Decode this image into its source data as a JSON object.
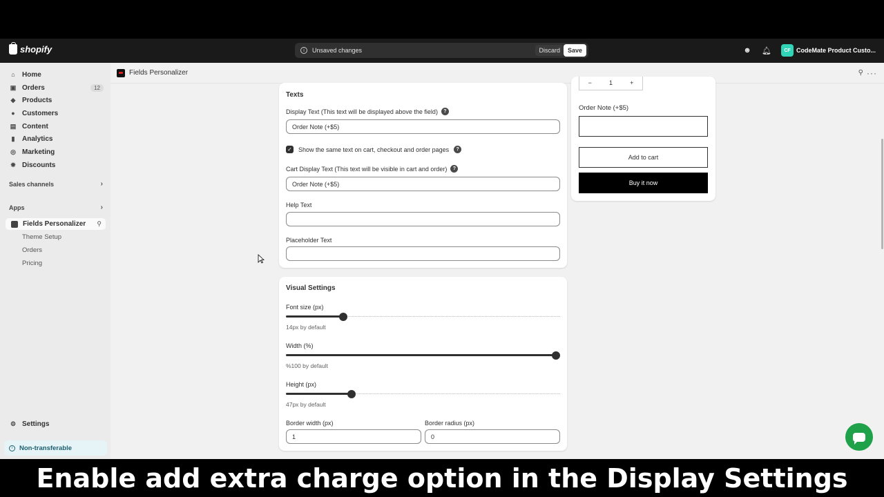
{
  "topbar": {
    "brand": "shopify",
    "unsaved_message": "Unsaved changes",
    "discard_label": "Discard",
    "save_label": "Save",
    "store_initials": "CF",
    "store_name": "CodeMate Product Custo..."
  },
  "sidebar": {
    "items": [
      {
        "label": "Home",
        "icon": "home-icon"
      },
      {
        "label": "Orders",
        "icon": "orders-icon",
        "badge": "12"
      },
      {
        "label": "Products",
        "icon": "tag-icon"
      },
      {
        "label": "Customers",
        "icon": "person-icon"
      },
      {
        "label": "Content",
        "icon": "content-icon"
      },
      {
        "label": "Analytics",
        "icon": "chart-icon"
      },
      {
        "label": "Marketing",
        "icon": "target-icon"
      },
      {
        "label": "Discounts",
        "icon": "discount-icon"
      }
    ],
    "sales_channels": "Sales channels",
    "apps": "Apps",
    "active_app": "Fields Personalizer",
    "app_subitems": [
      "Theme Setup",
      "Orders",
      "Pricing"
    ],
    "settings": "Settings",
    "non_transferable": "Non-transferable"
  },
  "app_header": {
    "title": "Fields Personalizer"
  },
  "texts_card": {
    "title": "Texts",
    "display_text_label": "Display Text (This text will be displayed above the field)",
    "display_text_value": "Order Note (+$5)",
    "same_text_label": "Show the same text on cart, checkout and order pages",
    "same_text_checked": true,
    "cart_display_label": "Cart Display Text (This text will be visible in cart and order)",
    "cart_display_value": "Order Note (+$5)",
    "help_text_label": "Help Text",
    "help_text_value": "",
    "placeholder_label": "Placeholder Text",
    "placeholder_value": ""
  },
  "visual_card": {
    "title": "Visual Settings",
    "font_size_label": "Font size (px)",
    "font_size_hint": "14px by default",
    "font_size_fraction": 0.21,
    "width_label": "Width (%)",
    "width_hint": "%100 by default",
    "width_fraction": 0.985,
    "height_label": "Height (px)",
    "height_hint": "47px by default",
    "height_fraction": 0.24,
    "border_width_label": "Border width (px)",
    "border_width_value": "1",
    "border_radius_label": "Border radius (px)",
    "border_radius_value": "0"
  },
  "preview": {
    "qty_value": "1",
    "qty_minus": "−",
    "qty_plus": "+",
    "field_label": "Order Note (+$5)",
    "add_to_cart": "Add to cart",
    "buy_now": "Buy it now"
  },
  "caption": "Enable add extra charge option in the Display Settings",
  "colors": {
    "accent_dark": "#303030",
    "chat_green": "#1fa14a",
    "nontransferable_bg": "#e6f4f7"
  }
}
